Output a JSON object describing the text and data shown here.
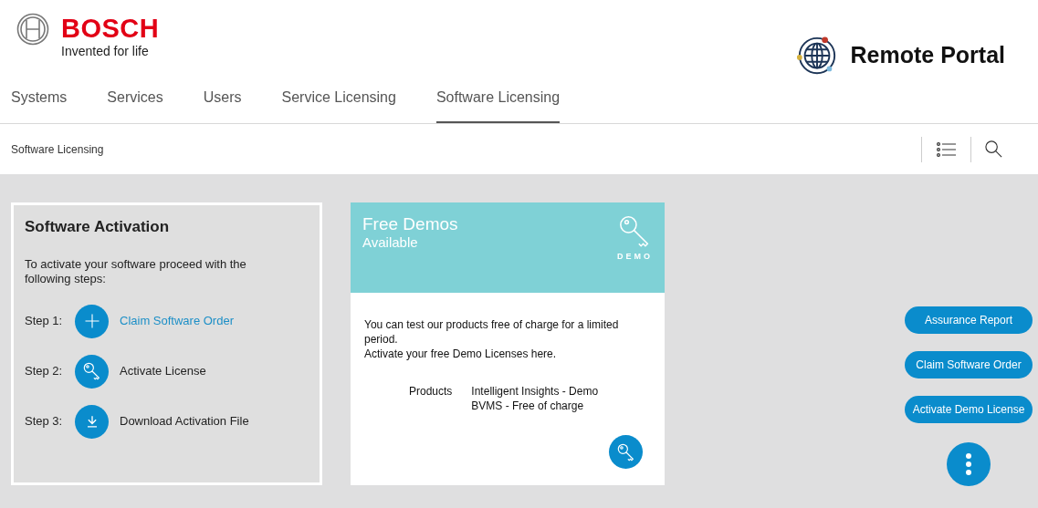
{
  "brand": {
    "name": "BOSCH",
    "tagline": "Invented for life"
  },
  "portal": {
    "title": "Remote Portal"
  },
  "tabs": [
    {
      "label": "Systems",
      "selected": false
    },
    {
      "label": "Services",
      "selected": false
    },
    {
      "label": "Users",
      "selected": false
    },
    {
      "label": "Service Licensing",
      "selected": false
    },
    {
      "label": "Software Licensing",
      "selected": true
    }
  ],
  "breadcrumb": "Software Licensing",
  "activation_card": {
    "title": "Software Activation",
    "intro": "To activate your software proceed with the following steps:",
    "steps": [
      {
        "label": "Step 1:",
        "kind": "plus",
        "action": "Claim Software Order",
        "link": true
      },
      {
        "label": "Step 2:",
        "kind": "key",
        "action": "Activate License",
        "link": false
      },
      {
        "label": "Step 3:",
        "kind": "download",
        "action": "Download Activation File",
        "link": false
      }
    ]
  },
  "demo_card": {
    "title": "Free Demos",
    "subtitle": "Available",
    "badge": "DEMO",
    "text_lines": [
      "You can test our products free of charge for a limited period.",
      "Activate your free Demo Licenses here."
    ],
    "products_label": "Products",
    "products": [
      "Intelligent Insights - Demo",
      "BVMS - Free of charge"
    ]
  },
  "actions": [
    "Assurance Report",
    "Claim Software Order",
    "Activate Demo License"
  ]
}
